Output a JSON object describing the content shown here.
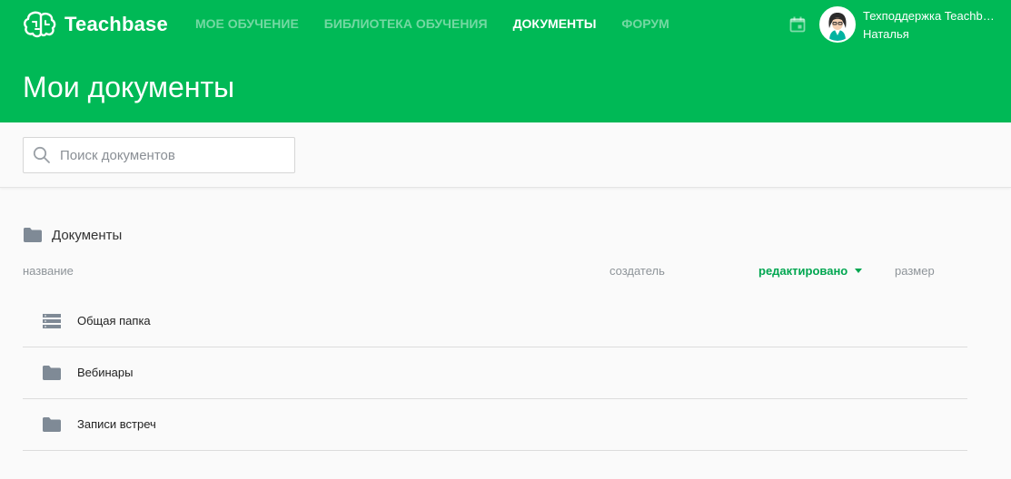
{
  "brand": {
    "name": "Teachbase",
    "color": "#00b956"
  },
  "nav": {
    "items": [
      {
        "label": "МОЕ ОБУЧЕНИЕ",
        "active": false
      },
      {
        "label": "БИБЛИОТЕКА ОБУЧЕНИЯ",
        "active": false
      },
      {
        "label": "ДОКУМЕНТЫ",
        "active": true
      },
      {
        "label": "ФОРУМ",
        "active": false
      }
    ]
  },
  "user": {
    "name": "Техподдержка Teachbase",
    "subtitle": "Наталья",
    "avatar_icon": "avatar-icon"
  },
  "page": {
    "title": "Мои документы"
  },
  "search": {
    "placeholder": "Поиск документов",
    "value": ""
  },
  "breadcrumb": {
    "label": "Документы",
    "icon": "folder-icon"
  },
  "columns": {
    "name": "название",
    "creator": "создатель",
    "edited": "редактировано",
    "size": "размер",
    "sorted_by": "edited",
    "sort_direction": "desc",
    "accent_color": "#00a650"
  },
  "rows": [
    {
      "label": "Общая папка",
      "icon": "list-icon"
    },
    {
      "label": "Вебинары",
      "icon": "folder-icon"
    },
    {
      "label": "Записи встреч",
      "icon": "folder-icon"
    }
  ]
}
